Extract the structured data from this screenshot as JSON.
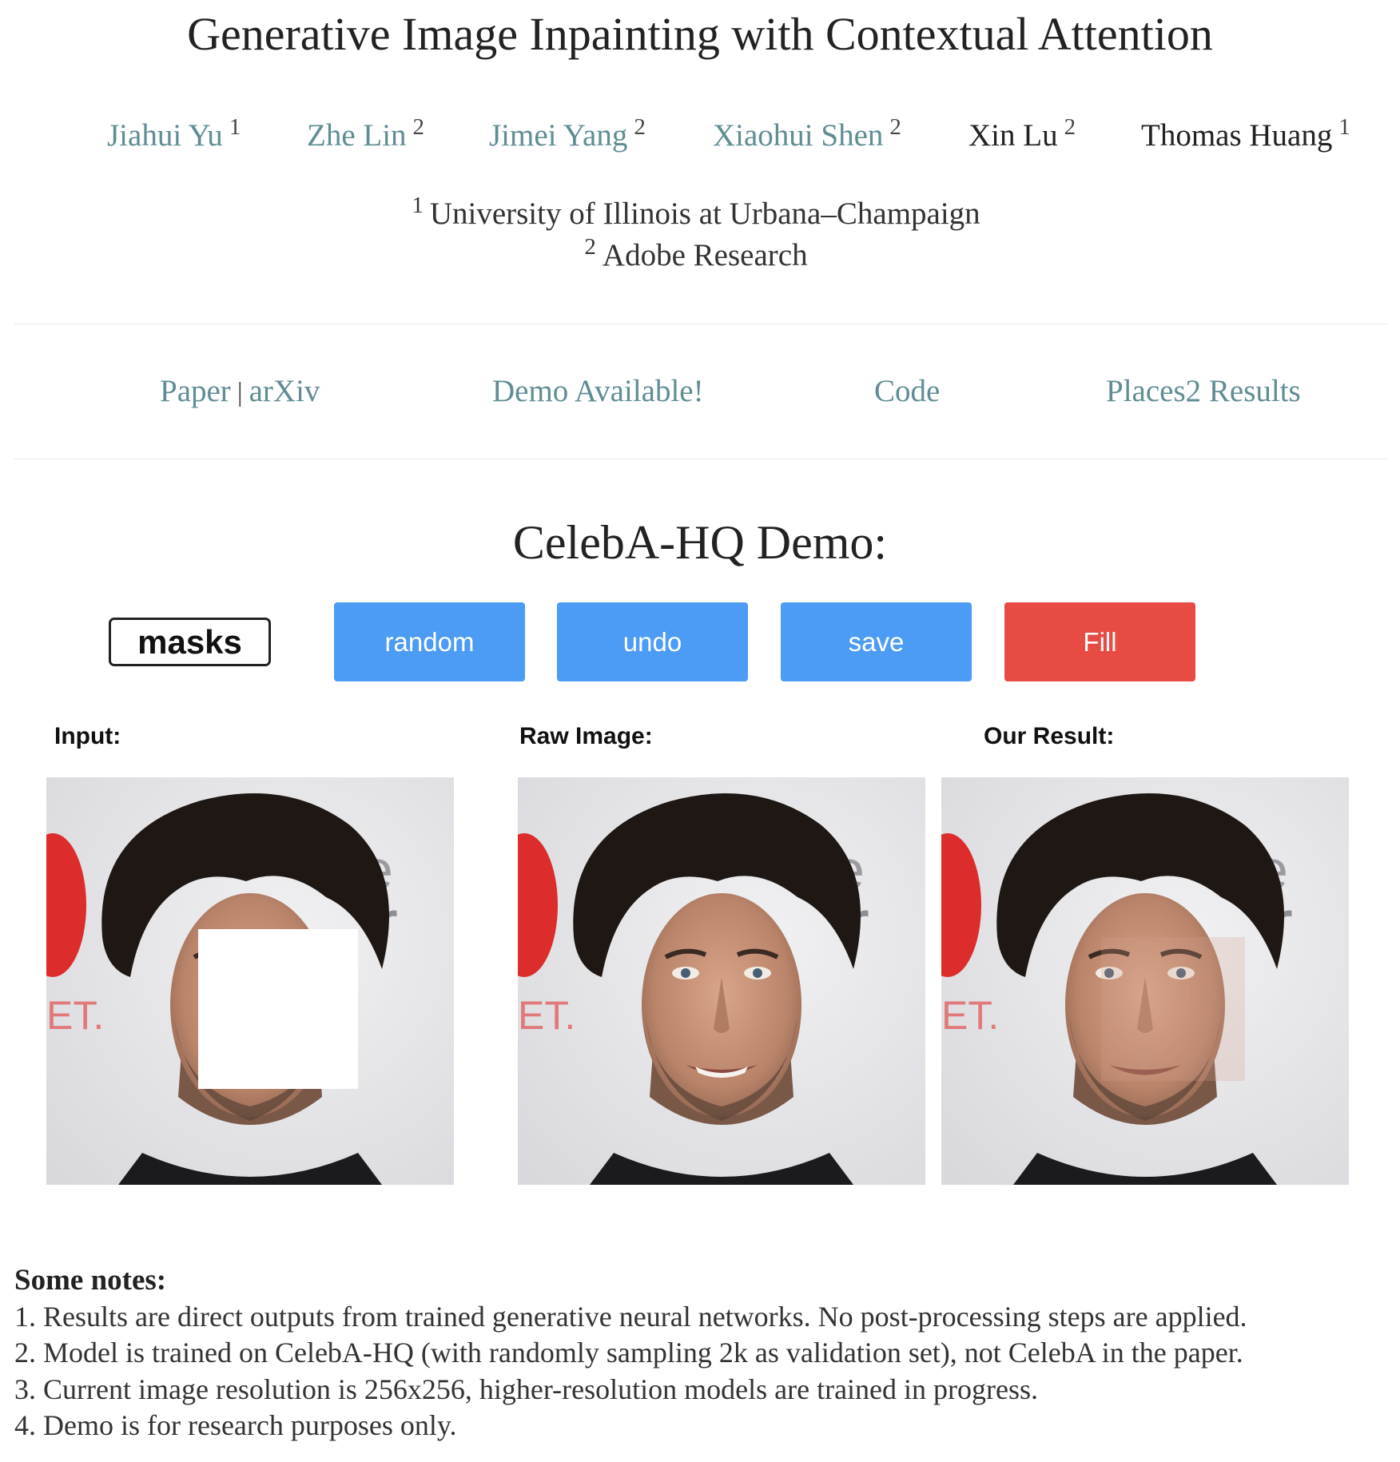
{
  "title": "Generative Image Inpainting with Contextual Attention",
  "authors": [
    {
      "name": "Jiahui Yu",
      "affil": "1",
      "link": true
    },
    {
      "name": "Zhe Lin",
      "affil": "2",
      "link": true
    },
    {
      "name": "Jimei Yang",
      "affil": "2",
      "link": true
    },
    {
      "name": "Xiaohui Shen",
      "affil": "2",
      "link": true
    },
    {
      "name": "Xin Lu",
      "affil": "2",
      "link": false
    },
    {
      "name": "Thomas Huang",
      "affil": "1",
      "link": false
    }
  ],
  "affiliations": [
    {
      "num": "1",
      "name": "University of Illinois at Urbana–Champaign"
    },
    {
      "num": "2",
      "name": "Adobe Research"
    }
  ],
  "nav": {
    "paper": "Paper",
    "separator": "|",
    "arxiv": "arXiv",
    "demo": "Demo Available!",
    "code": "Code",
    "places2": "Places2 Results"
  },
  "demo_heading": "CelebA-HQ Demo:",
  "toolbar": {
    "masks": "masks",
    "random": "random",
    "undo": "undo",
    "save": "save",
    "fill": "Fill"
  },
  "panels": {
    "input": "Input:",
    "raw": "Raw Image:",
    "result": "Our Result:"
  },
  "notes": {
    "heading": "Some notes:",
    "items": [
      "1. Results are direct outputs from trained generative neural networks. No post-processing steps are applied.",
      "2. Model is trained on CelebA-HQ (with randomly sampling 2k as validation set), not CelebA in the paper.",
      "3. Current image resolution is 256x256, higher-resolution models are trained in progress.",
      "4. Demo is for research purposes only."
    ]
  },
  "colors": {
    "link": "#5f8d93",
    "button_blue": "#4c9bf5",
    "button_red": "#e84b43"
  }
}
